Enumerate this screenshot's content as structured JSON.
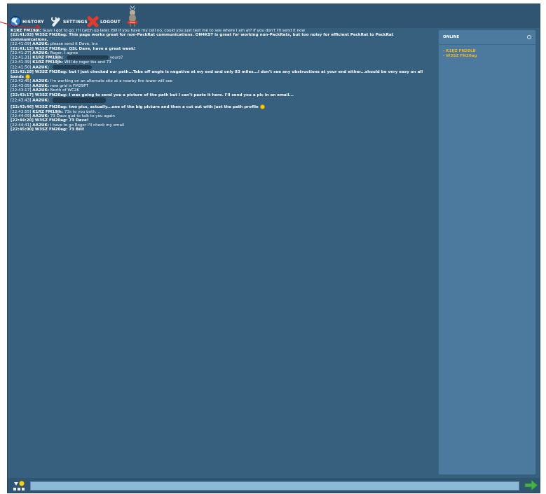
{
  "toolbar": {
    "history_label": "HISTORY",
    "settings_label": "SETTINGS",
    "logout_label": "LOGOUT"
  },
  "online": {
    "title": "ONLINE",
    "users": [
      "- K1IJZ FN20LB",
      "- W3SZ FN20ag"
    ]
  },
  "messages": [
    {
      "time": "",
      "who": "K1RZ FM19jh:",
      "text": "Guys I got to go. I'll catch up later. Bill If you have my cell no, could you just text me to see where I am at? If you don't I'll send it now",
      "bold": false
    },
    {
      "time": "[22:41:03]",
      "who": "W3SZ FN20ag:",
      "text": "This page works great for non-PackRat communications. ON4KST is great for working non-PackRats, but too noisy for efficient PackRat to PackRat communications.",
      "bold": true
    },
    {
      "time": "[22:41:09]",
      "who": "AA2UK:",
      "text": "please send it Dave, tnx",
      "bold": false
    },
    {
      "time": "[22:41:13]",
      "who": "W3SZ FN20ag:",
      "text": "QSL Dave, have a great week!",
      "bold": true
    },
    {
      "time": "[22:41:27]",
      "who": "AA2UK:",
      "text": "Roger, I agree",
      "bold": false
    },
    {
      "time": "[22:41:31]",
      "who": "K1RZ FM19jh:",
      "text": "yours?",
      "bold": false
    },
    {
      "time": "[22:41:39]",
      "who": "K1RZ FM19jh:",
      "text": "Will do roger tks and 73",
      "bold": false
    },
    {
      "time": "[22:41:50]",
      "who": "AA2UK:",
      "text": "",
      "bold": false
    },
    {
      "time": "[22:42:28]",
      "who": "W3SZ FN20ag:",
      "text": "but I just checked our path...Take off angle is negative at my end and only 83 miles...I don't see any obstructions at your end either...should be very easy on all bands",
      "bold": true
    },
    {
      "time": "[22:42:45]",
      "who": "AA2UK:",
      "text": "I'm working on an alternate site at a nearby fire tower will see",
      "bold": false
    },
    {
      "time": "[22:43:05]",
      "who": "AA2UK:",
      "text": "new grid is FM29PT",
      "bold": false
    },
    {
      "time": "[22:43:17]",
      "who": "AA2UK:",
      "text": "North of WC2K",
      "bold": false
    },
    {
      "time": "[22:43:17]",
      "who": "W3SZ FN20ag:",
      "text": "I was going to send you a picture of the path but I can't paste it here. I'll send you a pic in an email...",
      "bold": true
    },
    {
      "time": "[22:43:43]",
      "who": "AA2UK:",
      "text": "",
      "bold": false
    },
    {
      "time": "[22:43:46]",
      "who": "W3SZ FN20ag:",
      "text": "two pics, actually...one of the big picture and then a cut out with just the path profile",
      "bold": true
    },
    {
      "time": "[22:43:55]",
      "who": "K1RZ FM19jh:",
      "text": "73s to you both. ..",
      "bold": false
    },
    {
      "time": "[22:44:09]",
      "who": "AA2UK:",
      "text": "73 Dave gud to talk to you again",
      "bold": false
    },
    {
      "time": "[22:44:20]",
      "who": "W3SZ FN20ag:",
      "text": "73 Dave!",
      "bold": true
    },
    {
      "time": "[22:44:41]",
      "who": "AA2UK:",
      "text": "I have to go Roger I'll check my email",
      "bold": false
    },
    {
      "time": "[22:45:00]",
      "who": "W3SZ FN20ag:",
      "text": "73 Bill!",
      "bold": true
    }
  ],
  "colors": {
    "accent": "#f6b31a",
    "panel": "#37607f",
    "input": "#8cbad6",
    "send": "#46b04a"
  },
  "icons": [
    "history-icon",
    "settings-icon",
    "logout-icon",
    "logo-icon",
    "close-icon",
    "emoji-icon",
    "send-arrow-icon"
  ]
}
